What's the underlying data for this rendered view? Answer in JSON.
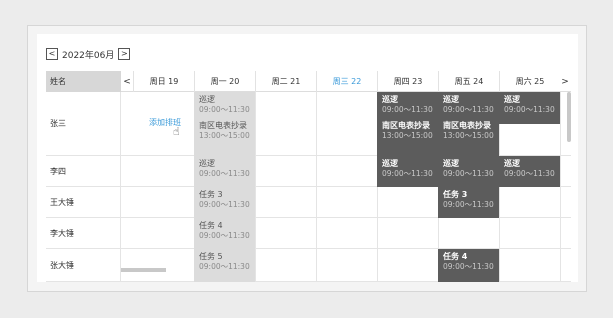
{
  "month_nav": {
    "prev": "<",
    "label": "2022年06月",
    "next": ">"
  },
  "header": {
    "name_col": "姓名",
    "prev": "<",
    "next": ">",
    "days": [
      "周日 19",
      "周一 20",
      "周二 21",
      "周三 22",
      "周四 23",
      "周五 24",
      "周六 25"
    ],
    "today_index": 3
  },
  "rows": [
    {
      "name": "张三"
    },
    {
      "name": "李四"
    },
    {
      "name": "王大锤"
    },
    {
      "name": "李大锤"
    },
    {
      "name": "张大锤"
    }
  ],
  "add_shift_label": "添加排班",
  "shifts": {
    "r0_mon": [
      {
        "title": "巡逻",
        "time": "09:00～11:30"
      },
      {
        "title": "南区电表抄录",
        "time": "13:00～15:00"
      }
    ],
    "r0_thu": [
      {
        "title": "巡逻",
        "time": "09:00～11:30"
      },
      {
        "title": "南区电表抄录",
        "time": "13:00～15:00"
      }
    ],
    "r0_fri": [
      {
        "title": "巡逻",
        "time": "09:00～11:30"
      },
      {
        "title": "南区电表抄录",
        "time": "13:00～15:00"
      }
    ],
    "r0_sat": [
      {
        "title": "巡逻",
        "time": "09:00～11:30"
      }
    ],
    "r1_mon": [
      {
        "title": "巡逻",
        "time": "09:00～11:30"
      }
    ],
    "r1_thu": [
      {
        "title": "巡逻",
        "time": "09:00～11:30"
      }
    ],
    "r1_fri": [
      {
        "title": "巡逻",
        "time": "09:00～11:30"
      }
    ],
    "r1_sat": [
      {
        "title": "巡逻",
        "time": "09:00～11:30"
      }
    ],
    "r2_mon": [
      {
        "title": "任务 3",
        "time": "09:00～11:30"
      }
    ],
    "r2_fri": [
      {
        "title": "任务 3",
        "time": "09:00～11:30"
      }
    ],
    "r3_mon": [
      {
        "title": "任务 4",
        "time": "09:00～11:30"
      }
    ],
    "r4_mon": [
      {
        "title": "任务 5",
        "time": "09:00～11:30"
      }
    ],
    "r4_fri": [
      {
        "title": "任务 4",
        "time": "09:00～11:30"
      }
    ]
  }
}
